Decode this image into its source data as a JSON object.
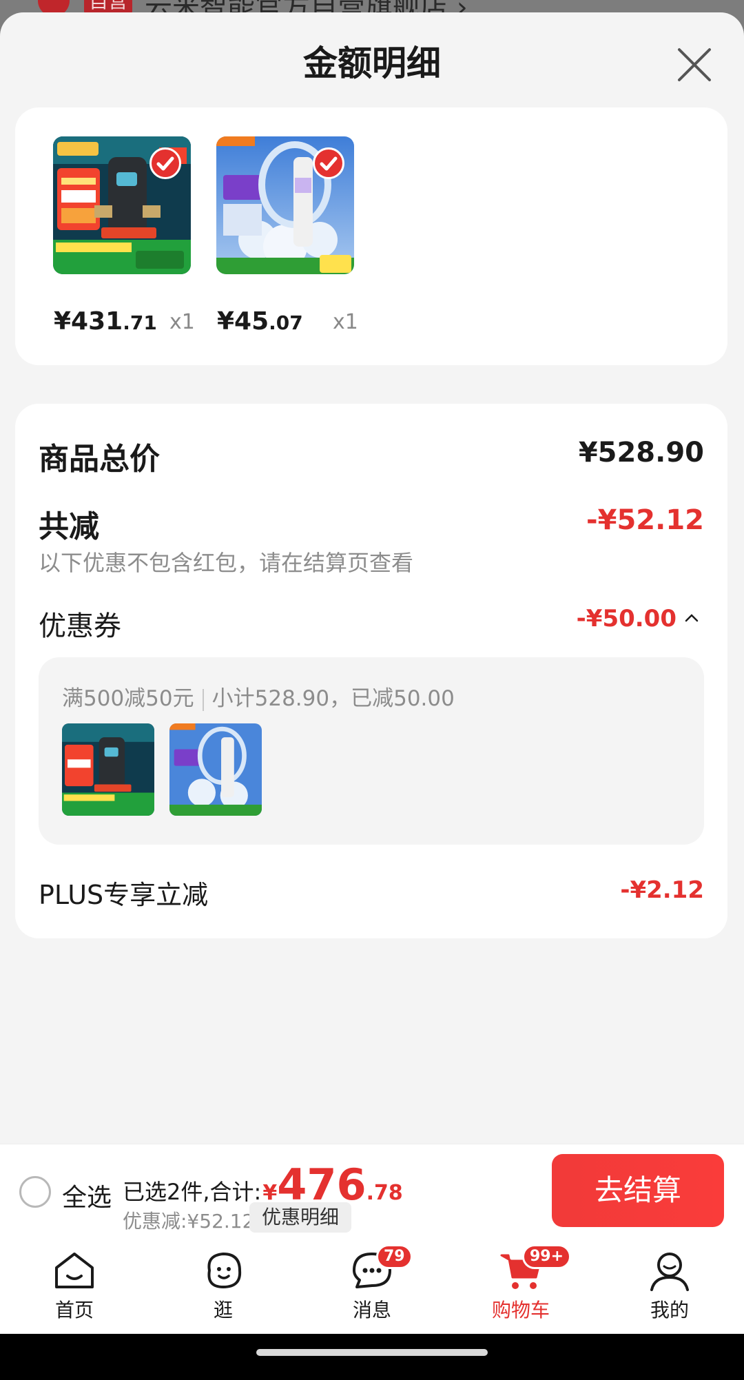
{
  "behind": {
    "badge": "自营",
    "store_name": "云米智能官方自营旗舰店 ›"
  },
  "sheet": {
    "title": "金额明细"
  },
  "products": [
    {
      "price_int": "¥431",
      "price_dec": ".71",
      "qty": "x1",
      "image_icon": "water-purifier-product-image"
    },
    {
      "price_int": "¥45",
      "price_dec": ".07",
      "qty": "x1",
      "image_icon": "filter-cartridge-product-image"
    }
  ],
  "totals": {
    "goods_total_label": "商品总价",
    "goods_total_value": "¥528.90",
    "reduce_label": "共减",
    "reduce_value": "-¥52.12",
    "reduce_note": "以下优惠不包含红包，请在结算页查看",
    "coupon_label": "优惠券",
    "coupon_value": "-¥50.00",
    "coupon_rule": "满500减50元",
    "coupon_subtotal": "小计528.90，已减50.00",
    "plus_label": "PLUS专享立减",
    "plus_value": "-¥2.12"
  },
  "checkout": {
    "select_all": "全选",
    "selected_text": "已选2件,合计:",
    "currency": "¥",
    "total_int": "476",
    "total_dec": ".78",
    "discount_text": "优惠减:¥52.12",
    "detail_button": "优惠明细",
    "pay_button": "去结算"
  },
  "tabbar": {
    "items": [
      {
        "label": "首页",
        "icon": "home-icon"
      },
      {
        "label": "逛",
        "icon": "browse-icon"
      },
      {
        "label": "消息",
        "icon": "message-icon",
        "badge": "79"
      },
      {
        "label": "购物车",
        "icon": "cart-icon",
        "badge": "99+",
        "active": true
      },
      {
        "label": "我的",
        "icon": "profile-icon"
      }
    ]
  },
  "colors": {
    "accent": "#e4312f",
    "background": "#f4f4f4",
    "card": "#ffffff"
  }
}
